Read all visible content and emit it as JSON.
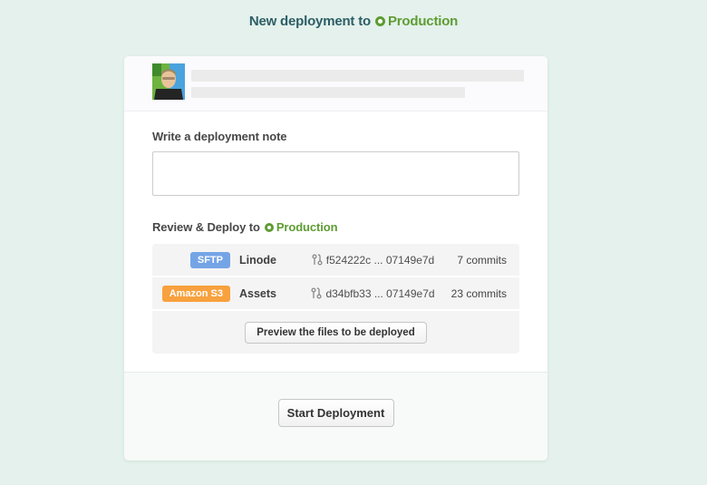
{
  "page": {
    "title_prefix": "New deployment to",
    "environment": "Production"
  },
  "note": {
    "label": "Write a deployment note",
    "value": ""
  },
  "review": {
    "heading_prefix": "Review & Deploy to",
    "environment": "Production",
    "servers": [
      {
        "badge": "SFTP",
        "name": "Linode",
        "revision_range": "f524222c ... 07149e7d",
        "commits": "7 commits"
      },
      {
        "badge": "Amazon S3",
        "name": "Assets",
        "revision_range": "d34bfb33 ... 07149e7d",
        "commits": "23 commits"
      }
    ],
    "preview_button": "Preview the files to be deployed"
  },
  "footer": {
    "start_button": "Start Deployment"
  },
  "colors": {
    "page_background": "#e4f1ec",
    "title_teal": "#2d5e66",
    "environment_green": "#5e9c33",
    "sftp_badge_blue": "#75a4e6",
    "amazon_s3_badge_orange": "#f8a13e",
    "panel_gray": "#f4f4f4"
  }
}
